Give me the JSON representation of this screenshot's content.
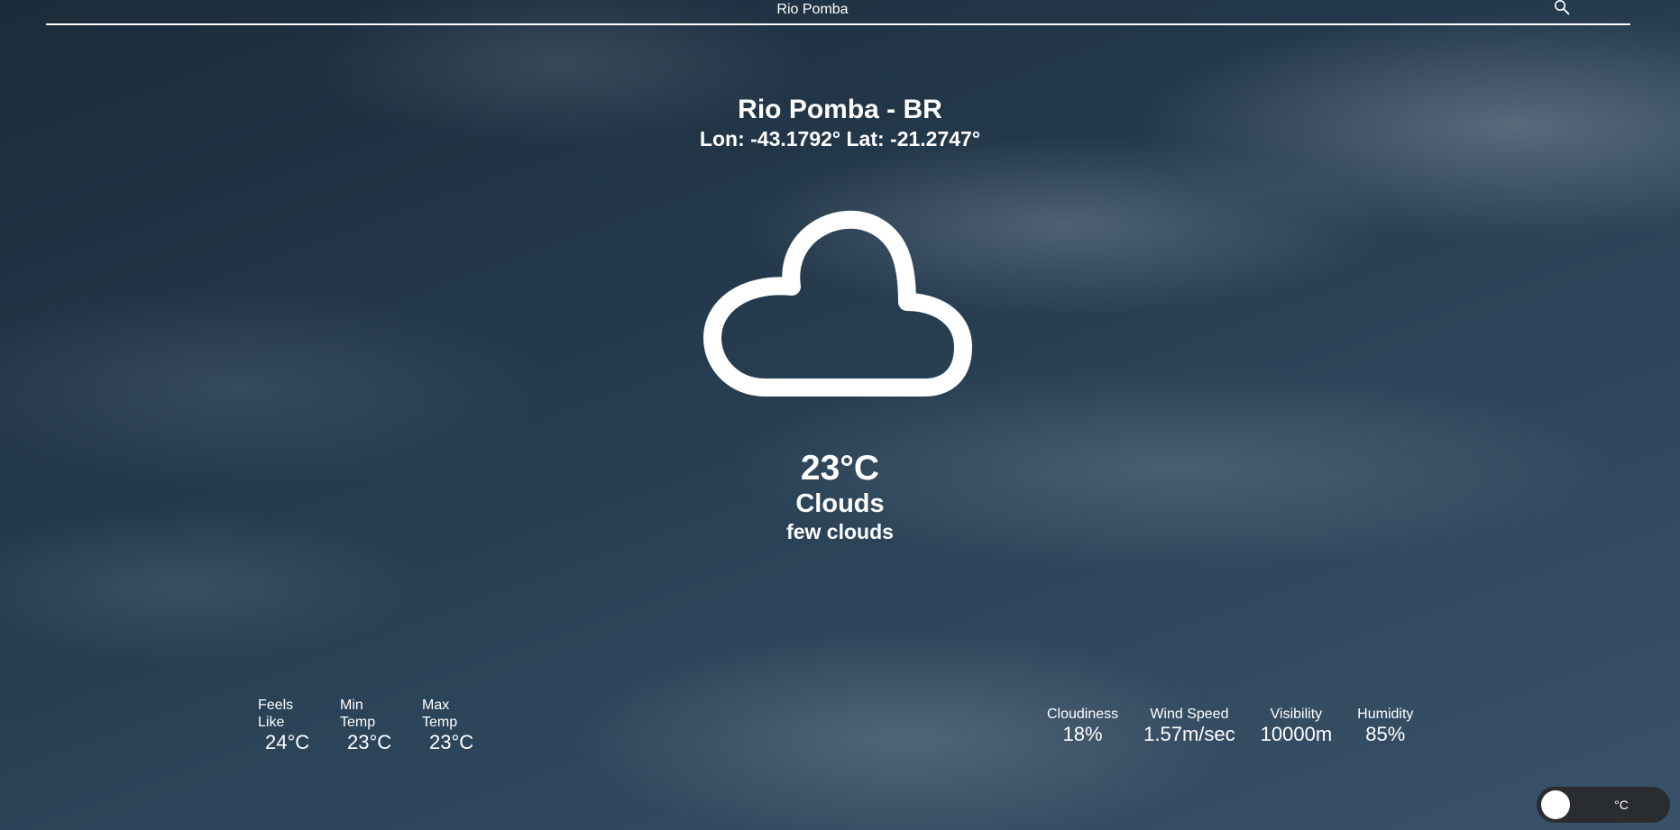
{
  "search": {
    "value": "Rio Pomba",
    "icon": "search-icon"
  },
  "location": {
    "title": "Rio Pomba - BR",
    "coordinates": "Lon: -43.1792° Lat: -21.2747°"
  },
  "current": {
    "icon": "cloud-icon",
    "temperature": "23°C",
    "condition": "Clouds",
    "description": "few clouds"
  },
  "stats_left": [
    {
      "label": "Feels Like",
      "value": "24°C"
    },
    {
      "label": "Min Temp",
      "value": "23°C"
    },
    {
      "label": "Max Temp",
      "value": "23°C"
    }
  ],
  "stats_right": [
    {
      "label": "Cloudiness",
      "value": "18%"
    },
    {
      "label": "Wind Speed",
      "value": "1.57m/sec"
    },
    {
      "label": "Visibility",
      "value": "10000m"
    },
    {
      "label": "Humidity",
      "value": "85%"
    }
  ],
  "unit_toggle": {
    "label": "°C"
  },
  "colors": {
    "text": "#ffffff",
    "toggle_bg": "#282828",
    "background": "#23384a"
  }
}
